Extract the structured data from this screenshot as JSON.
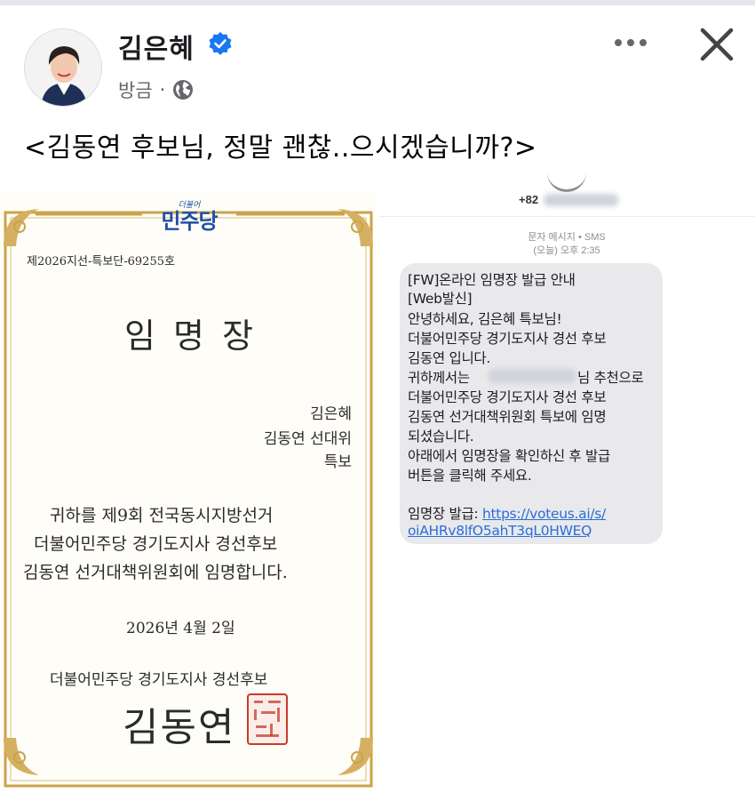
{
  "post": {
    "author": "김은혜",
    "time": "방금",
    "separator": "·",
    "text": "<김동연 후보님, 정말 괜찮..으시겠습니까?>"
  },
  "icons": {
    "verified": "verified-badge-icon",
    "audience": "globe-icon",
    "more": "more-options-icon",
    "close": "close-icon"
  },
  "colors": {
    "verified": "#1877f2",
    "party_blue": "#1f4ea8",
    "gold": "#c9a44a",
    "link": "#2a6ed8",
    "seal": "#c73a2e"
  },
  "certificate": {
    "party_small": "더불어",
    "party_big": "민주당",
    "number": "제2026지선-특보단-69255호",
    "title": "임 명 장",
    "recipient": [
      "김은혜",
      "김동연 선대위",
      "특보"
    ],
    "body": [
      "귀하를 제9회 전국동시지방선거",
      "더불어민주당 경기도지사 경선후보",
      "김동연 선거대책위원회에 임명합니다."
    ],
    "date": "2026년 4월 2일",
    "issuer": "더불어민주당 경기도지사 경선후보",
    "signature": "김동연"
  },
  "sms": {
    "sender_prefix": "+82",
    "message_type": "문자 메시지 • SMS",
    "timestamp": "(오늘) 오후 2:35",
    "lines": [
      "[FW]온라인 임명장 발급 안내",
      "[Web발신]",
      "안녕하세요, 김은혜 특보님!",
      "더불어민주당 경기도지사 경선 후보",
      "김동연 입니다.",
      "귀하께서는",
      "님 추천으로",
      "더불어민주당 경기도지사 경선 후보",
      "김동연 선거대책위원회 특보에 임명",
      "되셨습니다.",
      "아래에서 임명장을 확인하신 후 발급",
      "버튼을 클릭해 주세요."
    ],
    "link_label": "임명장 발급:",
    "link_part1": "https://voteus.ai/s/",
    "link_part2": "oiAHRv8lfO5ahT3qL0HWEQ"
  }
}
